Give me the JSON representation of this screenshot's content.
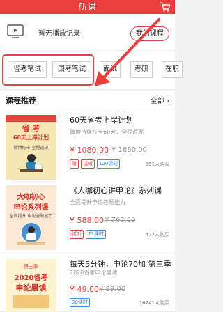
{
  "header": {
    "title": "听课",
    "cart_icon": "shopping-cart-icon"
  },
  "history": {
    "icon": "tv-icon",
    "text": "暂无播放记录",
    "my_courses": "我的课程"
  },
  "categories": [
    "省考笔试",
    "国考笔试",
    "面试",
    "考研",
    "在职"
  ],
  "section": {
    "title": "课程推荐",
    "all": "全部 ›"
  },
  "courses": [
    {
      "title": "60天省考上岸计划",
      "subtitle": "微博持续打卡60天，全程返现",
      "price": "¥ 1080.00",
      "old_price": "¥ 1680.00",
      "tags": [
        {
          "text": "赠",
          "color": "red"
        },
        {
          "text": "试听",
          "color": "red"
        },
        {
          "text": "120课时",
          "color": "blue"
        }
      ],
      "buyers": "351人购买",
      "cover": {
        "line1": "省  考",
        "line2": "60天上岸计划",
        "line3": "微博打卡 全程返现",
        "bg": "#f6e7b4",
        "accent": "#e0443a"
      }
    },
    {
      "title": "《大咖初心讲申论》系列课",
      "subtitle": "全面提升申论答题能力",
      "price": "¥ 588.00",
      "old_price": "¥ 762.00",
      "tags": [
        {
          "text": "试听",
          "color": "red"
        },
        {
          "text": "75课时",
          "color": "blue"
        }
      ],
      "buyers": "477人购买",
      "cover": {
        "line1": "大咖初心",
        "line2": "申论系列课",
        "line3": "全面提升 申论答题能力",
        "bg": "#fbe9d5",
        "accent": "#d9342b"
      }
    },
    {
      "title": "每天5分钟，申论70加 第三季",
      "subtitle": "2020省考申论晨读",
      "price": "¥ 49.00",
      "old_price": "¥ 99.00",
      "tags": [
        {
          "text": "30课时",
          "color": "blue"
        }
      ],
      "buyers": "16741人购买",
      "cover": {
        "line1": "第三季",
        "line2": "2020省考",
        "line3": "申论晨读",
        "bg": "#fdf3d0",
        "accent": "#d9342b"
      }
    }
  ],
  "colors": {
    "brand": "#e8403f",
    "accent_blue": "#3a8ee6"
  }
}
